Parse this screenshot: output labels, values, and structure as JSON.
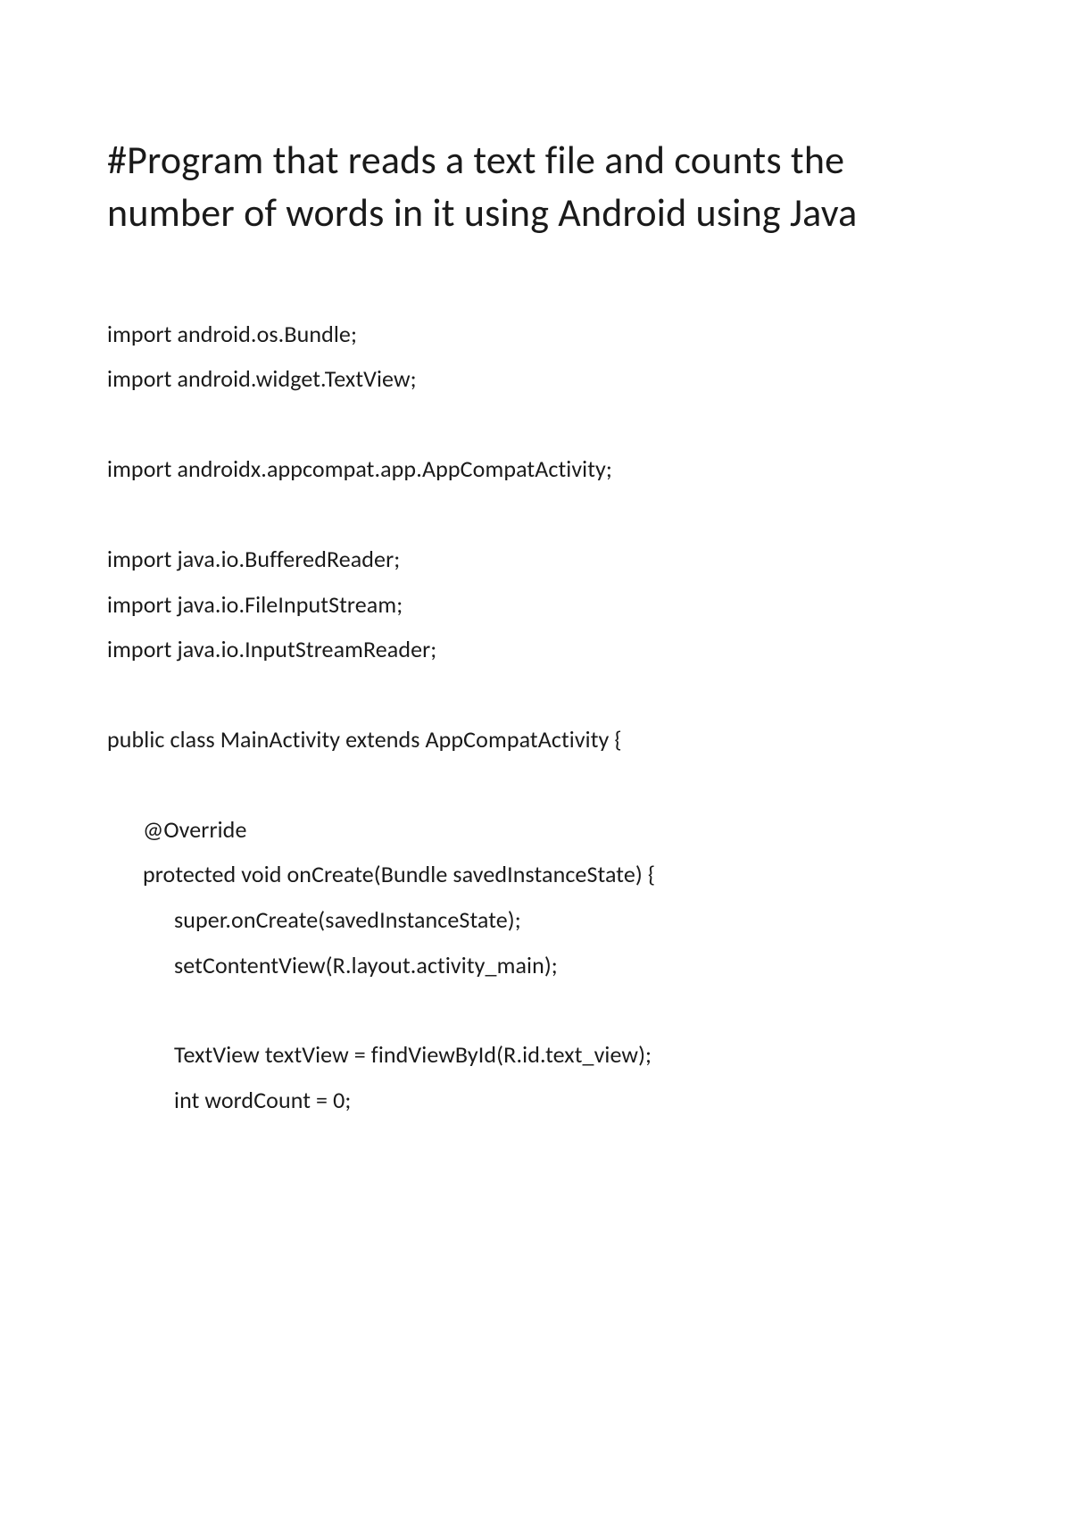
{
  "title": "#Program that reads a text file and counts the number of words in it using Android using Java",
  "code": {
    "line1": "import android.os.Bundle;",
    "line2": "import android.widget.TextView;",
    "line3": "import androidx.appcompat.app.AppCompatActivity;",
    "line4": "import java.io.BufferedReader;",
    "line5": "import java.io.FileInputStream;",
    "line6": "import java.io.InputStreamReader;",
    "line7": "public class MainActivity extends AppCompatActivity {",
    "line8": "@Override",
    "line9": "protected void onCreate(Bundle savedInstanceState) {",
    "line10": "super.onCreate(savedInstanceState);",
    "line11": "setContentView(R.layout.activity_main);",
    "line12": "TextView textView = findViewById(R.id.text_view);",
    "line13": "int wordCount = 0;"
  }
}
